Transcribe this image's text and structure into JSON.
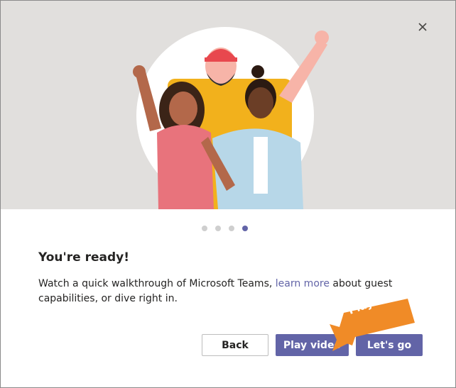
{
  "dialog": {
    "close_icon": "close-icon",
    "illustration": "people-waving-illustration",
    "pager": {
      "count": 4,
      "active_index": 3
    },
    "title": "You're ready!",
    "body": {
      "before_link": "Watch a quick walkthrough of Microsoft Teams, ",
      "link": "learn more",
      "after_link": " about guest capabilities, or dive right in."
    },
    "buttons": {
      "back": "Back",
      "play_video": "Play video",
      "lets_go": "Let's go"
    },
    "callout": {
      "label": "Play video",
      "color": "#f08b27"
    },
    "colors": {
      "accent": "#6264a7",
      "hero_background": "#e1dfdd"
    }
  }
}
